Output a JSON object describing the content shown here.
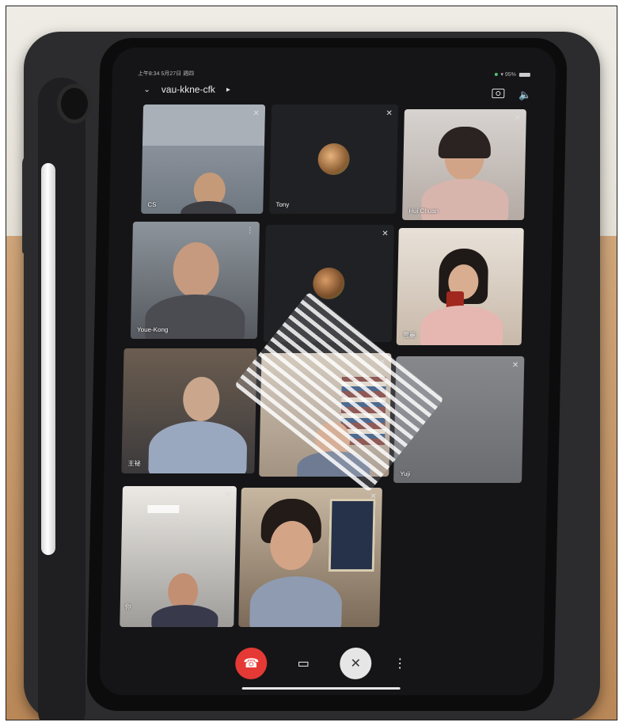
{
  "status": {
    "time": "上午8:34  5月27日 週四",
    "battery": "95%"
  },
  "meeting": {
    "code": "vau-kkne-cfk"
  },
  "participants": [
    {
      "name": "CS",
      "muted": true
    },
    {
      "name": "Tony",
      "muted": true
    },
    {
      "name": "Hui Chuan",
      "muted": true
    },
    {
      "name": "Youe-Kong",
      "muted": false
    },
    {
      "name": "",
      "muted": true
    },
    {
      "name": "雪麗",
      "muted": true
    },
    {
      "name": "王祕",
      "muted": false
    },
    {
      "name": "",
      "muted": true
    },
    {
      "name": "Yuji",
      "muted": true
    },
    {
      "name": "你",
      "muted": true
    },
    {
      "name": "",
      "muted": true
    }
  ],
  "controls": {
    "end_call_icon": "phone-hangup-icon",
    "video_icon": "video-camera-icon",
    "mic_icon": "mic-off-icon",
    "more_icon": "more-vert-icon"
  },
  "colors": {
    "end_call": "#e53935",
    "tile_bg": "#2b2c30",
    "screen_bg": "#151517"
  }
}
